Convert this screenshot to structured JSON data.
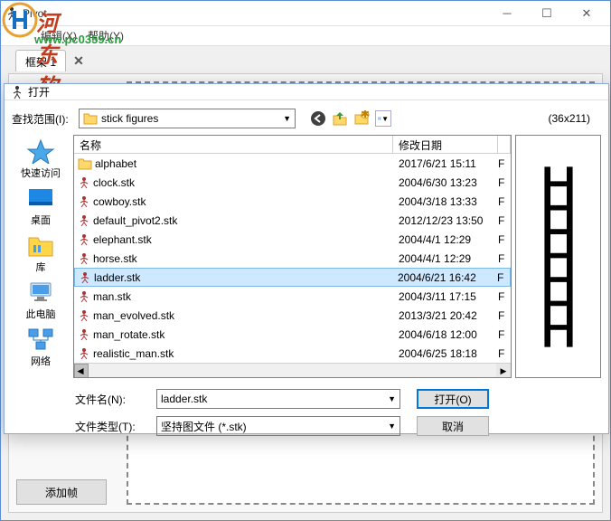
{
  "main": {
    "title": "Pivot",
    "menu": {
      "edit": "编辑(X)",
      "help": "帮助(Y)"
    },
    "tab1": "框架 1",
    "add_frame": "添加帧"
  },
  "watermark": {
    "brand": "河东软件园",
    "url": "www.pc0359.cn"
  },
  "dialog": {
    "title": "打开",
    "look_in_label": "查找范围(I):",
    "folder": "stick figures",
    "preview_dim": "(36x211)",
    "places": {
      "quick": "快速访问",
      "desktop": "桌面",
      "libraries": "库",
      "thispc": "此电脑",
      "network": "网络"
    },
    "columns": {
      "name": "名称",
      "date": "修改日期"
    },
    "files": [
      {
        "name": "alphabet",
        "date": "2017/6/21 15:11",
        "type": "folder",
        "selected": false
      },
      {
        "name": "clock.stk",
        "date": "2004/6/30 13:23",
        "type": "stk",
        "selected": false
      },
      {
        "name": "cowboy.stk",
        "date": "2004/3/18 13:33",
        "type": "stk",
        "selected": false
      },
      {
        "name": "default_pivot2.stk",
        "date": "2012/12/23 13:50",
        "type": "stk",
        "selected": false
      },
      {
        "name": "elephant.stk",
        "date": "2004/4/1 12:29",
        "type": "stk",
        "selected": false
      },
      {
        "name": "horse.stk",
        "date": "2004/4/1 12:29",
        "type": "stk",
        "selected": false
      },
      {
        "name": "ladder.stk",
        "date": "2004/6/21 16:42",
        "type": "stk",
        "selected": true
      },
      {
        "name": "man.stk",
        "date": "2004/3/11 17:15",
        "type": "stk",
        "selected": false
      },
      {
        "name": "man_evolved.stk",
        "date": "2013/3/21 20:42",
        "type": "stk",
        "selected": false
      },
      {
        "name": "man_rotate.stk",
        "date": "2004/6/18 12:00",
        "type": "stk",
        "selected": false
      },
      {
        "name": "realistic_man.stk",
        "date": "2004/6/25 18:18",
        "type": "stk",
        "selected": false
      }
    ],
    "filename_label": "文件名(N):",
    "filename_value": "ladder.stk",
    "filetype_label": "文件类型(T):",
    "filetype_value": "坚持图文件 (*.stk)",
    "open_btn": "打开(O)",
    "cancel_btn": "取消"
  }
}
